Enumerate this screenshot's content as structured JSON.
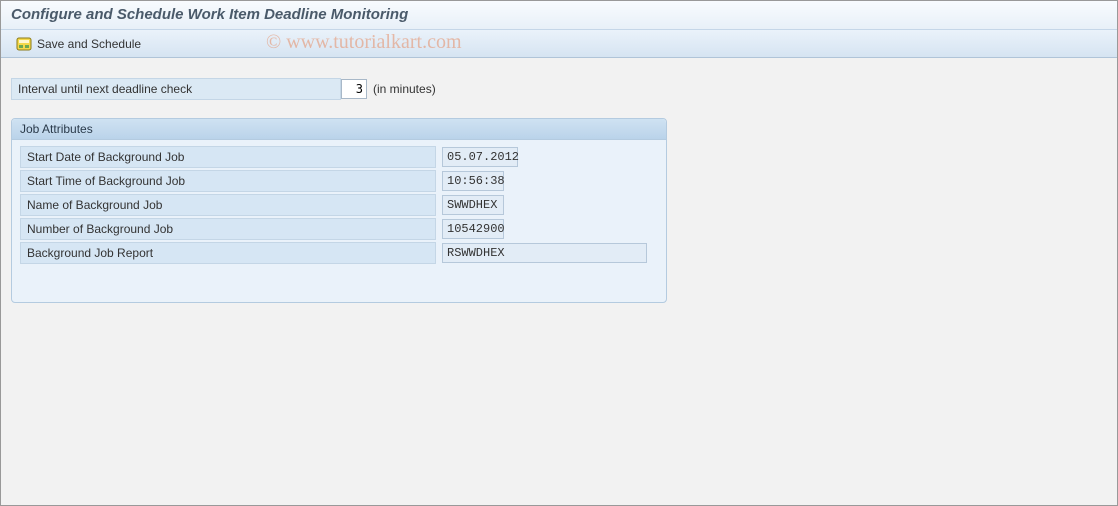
{
  "header": {
    "title": "Configure and Schedule Work Item Deadline Monitoring"
  },
  "toolbar": {
    "save_schedule_label": "Save and Schedule"
  },
  "interval": {
    "label": "Interval until next deadline check",
    "value": "3",
    "unit_hint": "(in minutes)"
  },
  "jobattrs": {
    "groupbox_title": "Job Attributes",
    "rows": [
      {
        "label": "Start Date of Background Job",
        "value": "05.07.2012",
        "cls": "w-date"
      },
      {
        "label": "Start Time of Background Job",
        "value": "10:56:38",
        "cls": "w-time"
      },
      {
        "label": "Name of Background Job",
        "value": "SWWDHEX",
        "cls": "w-name"
      },
      {
        "label": "Number of Background Job",
        "value": "10542900",
        "cls": "w-num"
      },
      {
        "label": "Background Job Report",
        "value": "RSWWDHEX",
        "cls": "w-rep"
      }
    ]
  },
  "watermark": "© www.tutorialkart.com"
}
